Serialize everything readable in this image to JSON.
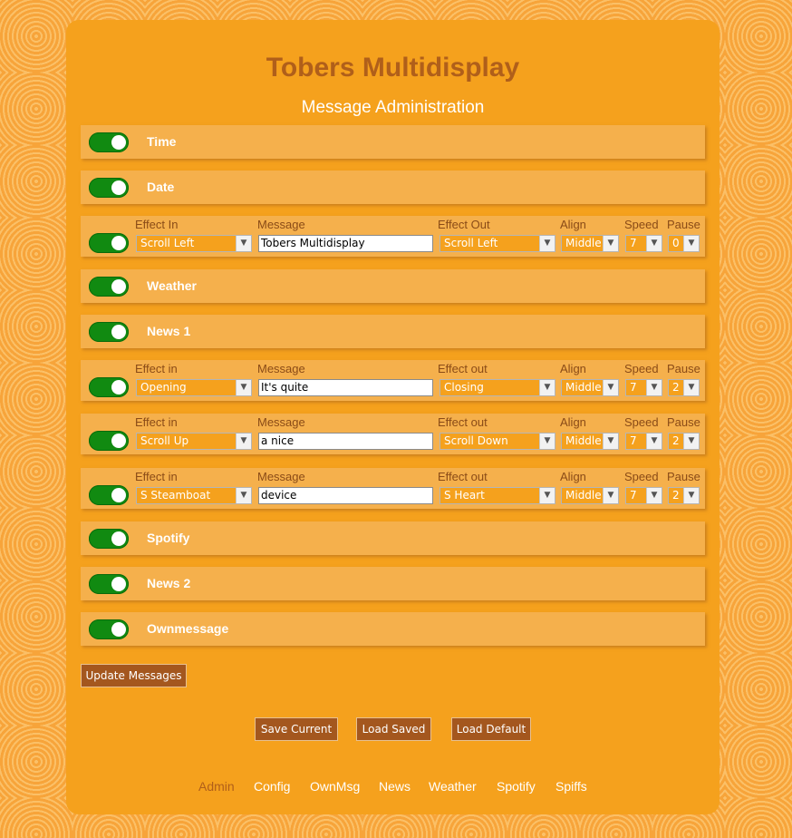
{
  "app": {
    "title": "Tobers Multidisplay",
    "subtitle": "Message Administration"
  },
  "rows": [
    {
      "kind": "simple",
      "label": "Time",
      "enabled": true
    },
    {
      "kind": "simple",
      "label": "Date",
      "enabled": true
    },
    {
      "kind": "detail",
      "enabled": true,
      "headers": {
        "effect_in": "Effect In",
        "message": "Message",
        "effect_out": "Effect Out",
        "align": "Align",
        "speed": "Speed",
        "pause": "Pause"
      },
      "effect_in": "Scroll Left",
      "message": "Tobers Multidisplay",
      "effect_out": "Scroll Left",
      "align": "Middle",
      "speed": "7",
      "pause": "0"
    },
    {
      "kind": "simple",
      "label": "Weather",
      "enabled": true
    },
    {
      "kind": "simple",
      "label": "News 1",
      "enabled": true
    },
    {
      "kind": "detail",
      "enabled": true,
      "headers": {
        "effect_in": "Effect in",
        "message": "Message",
        "effect_out": "Effect out",
        "align": "Align",
        "speed": "Speed",
        "pause": "Pause"
      },
      "effect_in": "Opening",
      "message": "It's quite",
      "effect_out": "Closing",
      "align": "Middle",
      "speed": "7",
      "pause": "2"
    },
    {
      "kind": "detail",
      "enabled": true,
      "headers": {
        "effect_in": "Effect in",
        "message": "Message",
        "effect_out": "Effect out",
        "align": "Align",
        "speed": "Speed",
        "pause": "Pause"
      },
      "effect_in": "Scroll Up",
      "message": "a nice",
      "effect_out": "Scroll Down",
      "align": "Middle",
      "speed": "7",
      "pause": "2"
    },
    {
      "kind": "detail",
      "enabled": true,
      "headers": {
        "effect_in": "Effect in",
        "message": "Message",
        "effect_out": "Effect out",
        "align": "Align",
        "speed": "Speed",
        "pause": "Pause"
      },
      "effect_in": "S Steamboat",
      "message": "device",
      "effect_out": "S Heart",
      "align": "Middle",
      "speed": "7",
      "pause": "2"
    },
    {
      "kind": "simple",
      "label": "Spotify",
      "enabled": true
    },
    {
      "kind": "simple",
      "label": "News 2",
      "enabled": true
    },
    {
      "kind": "simple",
      "label": "Ownmessage",
      "enabled": true
    }
  ],
  "buttons": {
    "update": "Update Messages",
    "save_current": "Save Current",
    "load_saved": "Load Saved",
    "load_default": "Load Default"
  },
  "nav": {
    "items": [
      "Admin",
      "Config",
      "OwnMsg",
      "News",
      "Weather",
      "Spotify",
      "Spiffs"
    ],
    "active": "Admin"
  },
  "colors": {
    "background": "#f7a43a",
    "panel": "#f5a11d",
    "row": "#f5b04c",
    "title": "#b05f1a",
    "toggle_on": "#118a11",
    "button": "#a4571e"
  },
  "icons": {
    "toggle": "toggle-switch-icon",
    "dropdown": "chevron-down-icon"
  }
}
